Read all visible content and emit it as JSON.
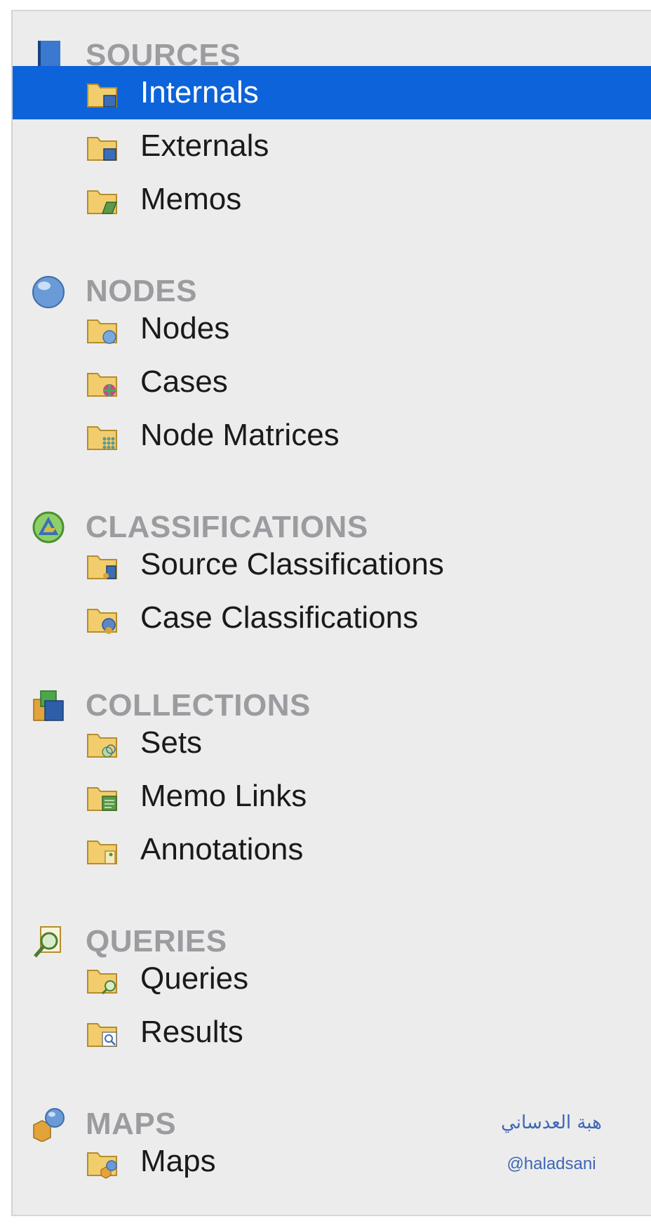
{
  "colors": {
    "selection": "#0d63d9",
    "header_text": "#9b9ba0",
    "item_text": "#1a1a1a"
  },
  "sections": [
    {
      "title": "SOURCES",
      "icon": "book-icon",
      "items": [
        {
          "label": "Internals",
          "icon": "folder-internals-icon",
          "selected": true
        },
        {
          "label": "Externals",
          "icon": "folder-externals-icon"
        },
        {
          "label": "Memos",
          "icon": "folder-memos-icon"
        }
      ]
    },
    {
      "title": "NODES",
      "icon": "sphere-icon",
      "items": [
        {
          "label": "Nodes",
          "icon": "folder-nodes-icon"
        },
        {
          "label": "Cases",
          "icon": "folder-cases-icon"
        },
        {
          "label": "Node Matrices",
          "icon": "folder-matrices-icon"
        }
      ]
    },
    {
      "title": "CLASSIFICATIONS",
      "icon": "classification-icon",
      "items": [
        {
          "label": "Source Classifications",
          "icon": "folder-source-classifications-icon"
        },
        {
          "label": "Case Classifications",
          "icon": "folder-case-classifications-icon"
        }
      ]
    },
    {
      "title": "COLLECTIONS",
      "icon": "collections-icon",
      "items": [
        {
          "label": "Sets",
          "icon": "folder-sets-icon"
        },
        {
          "label": "Memo Links",
          "icon": "folder-memo-links-icon"
        },
        {
          "label": "Annotations",
          "icon": "folder-annotations-icon"
        }
      ]
    },
    {
      "title": "QUERIES",
      "icon": "query-icon",
      "items": [
        {
          "label": "Queries",
          "icon": "folder-queries-icon"
        },
        {
          "label": "Results",
          "icon": "folder-results-icon"
        }
      ]
    },
    {
      "title": "MAPS",
      "icon": "maps-icon",
      "items": [
        {
          "label": "Maps",
          "icon": "folder-maps-icon"
        }
      ]
    }
  ],
  "watermark": {
    "arabic": "هبة العدساني",
    "handle": "@haladsani"
  }
}
